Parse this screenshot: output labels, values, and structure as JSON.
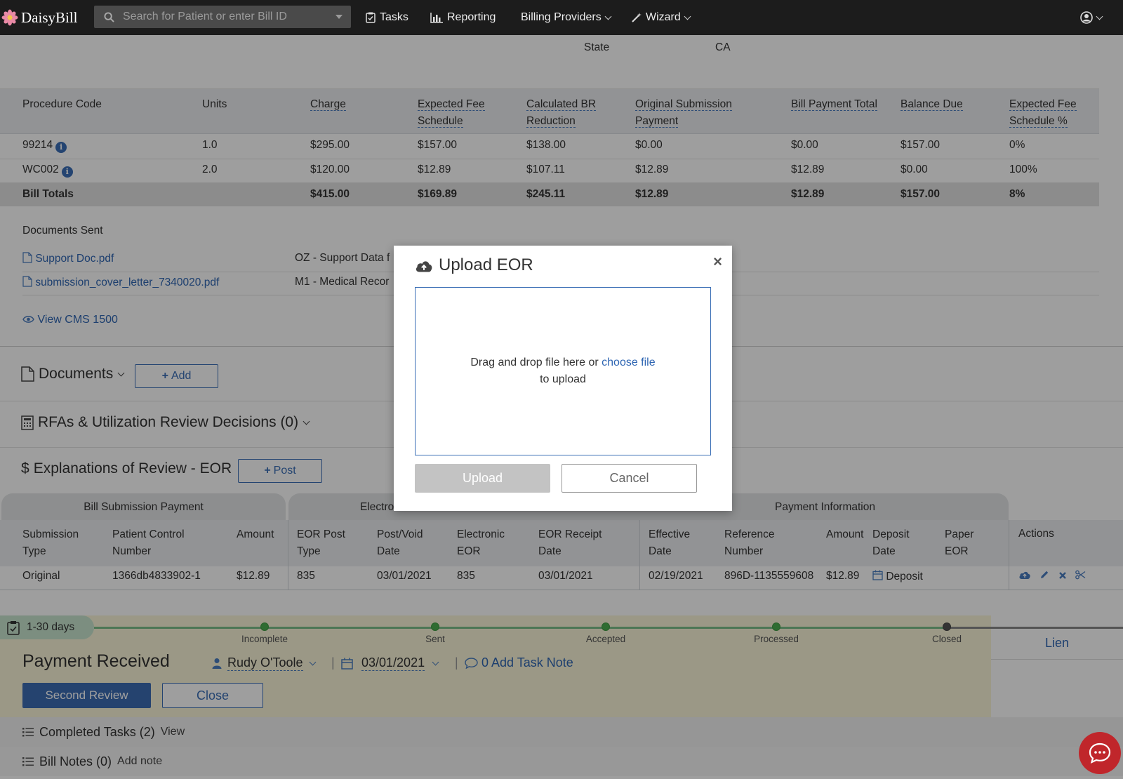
{
  "app": {
    "name": "DaisyBill"
  },
  "nav": {
    "search_placeholder": "Search for Patient or enter Bill ID",
    "tasks": "Tasks",
    "reporting": "Reporting",
    "billing_providers": "Billing Providers",
    "wizard": "Wizard"
  },
  "state": {
    "label": "State",
    "value": "CA"
  },
  "procedures": {
    "headers": {
      "code": "Procedure Code",
      "units": "Units",
      "charge": "Charge",
      "efs_1": "Expected Fee",
      "efs_2": "Schedule",
      "br_1": "Calculated BR",
      "br_2": "Reduction",
      "osp_1": "Original Submission",
      "osp_2": "Payment",
      "bpt": "Bill Payment Total",
      "balance": "Balance Due",
      "efsp_1": "Expected Fee",
      "efsp_2": "Schedule %"
    },
    "rows": [
      {
        "code": "99214",
        "units": "1.0",
        "charge": "$295.00",
        "efs": "$157.00",
        "br": "$138.00",
        "osp": "$0.00",
        "bpt": "$0.00",
        "balance": "$157.00",
        "efsp": "0%"
      },
      {
        "code": "WC002",
        "units": "2.0",
        "charge": "$120.00",
        "efs": "$12.89",
        "br": "$107.11",
        "osp": "$12.89",
        "bpt": "$12.89",
        "balance": "$0.00",
        "efsp": "100%"
      }
    ],
    "totals": {
      "label": "Bill Totals",
      "charge": "$415.00",
      "efs": "$169.89",
      "br": "$245.11",
      "osp": "$12.89",
      "bpt": "$12.89",
      "balance": "$157.00",
      "efsp": "8%"
    }
  },
  "documents_sent": {
    "title": "Documents Sent",
    "files": [
      {
        "name": "Support Doc.pdf",
        "type": "OZ - Support Data f"
      },
      {
        "name": "submission_cover_letter_7340020.pdf",
        "type": "M1 - Medical Recor"
      }
    ],
    "view_cms": "View CMS 1500"
  },
  "sections": {
    "documents": "Documents",
    "add": "Add",
    "rfas": "RFAs & Utilization Review Decisions (0)",
    "eor": "Explanations of Review - EOR",
    "post": "Post"
  },
  "eor_table": {
    "groups": {
      "bill_submission": "Bill Submission Payment",
      "electronic": "Electro",
      "payment_info": "Payment Information"
    },
    "headers": {
      "sub_type_1": "Submission",
      "sub_type_2": "Type",
      "pcn_1": "Patient Control",
      "pcn_2": "Number",
      "amount": "Amount",
      "post_type_1": "EOR Post",
      "post_type_2": "Type",
      "pv_1": "Post/Void",
      "pv_2": "Date",
      "el_1": "Electronic",
      "el_2": "EOR",
      "receipt_1": "EOR Receipt",
      "receipt_2": "Date",
      "eff_1": "Effective",
      "eff_2": "Date",
      "ref_1": "Reference",
      "ref_2": "Number",
      "pay_amount": "Amount",
      "dep_1": "Deposit",
      "dep_2": "Date",
      "paper_1": "Paper",
      "paper_2": "EOR",
      "actions": "Actions"
    },
    "row": {
      "sub_type": "Original",
      "pcn": "1366db4833902-1",
      "amount": "$12.89",
      "post_type": "835",
      "pv_date": "03/01/2021",
      "electronic_eor": "835",
      "receipt_date": "03/01/2021",
      "eff_date": "02/19/2021",
      "ref": "896D-1135559608",
      "pay_amount": "$12.89",
      "deposit": "Deposit"
    }
  },
  "status": {
    "days": "1-30 days",
    "steps": [
      "Incomplete",
      "Sent",
      "Accepted",
      "Processed",
      "Closed"
    ],
    "title": "Payment Received",
    "assignee": "Rudy O'Toole",
    "date": "03/01/2021",
    "task_note": "0 Add Task Note",
    "second_review": "Second Review",
    "close": "Close",
    "lien": "Lien"
  },
  "footer": {
    "completed_tasks": "Completed Tasks (2)",
    "view": "View",
    "bill_notes": "Bill Notes (0)",
    "add_note": "Add note"
  },
  "modal": {
    "title": "Upload EOR",
    "drop_text": "Drag and drop file here or",
    "choose_file": "choose file",
    "to_upload": "to upload",
    "upload": "Upload",
    "cancel": "Cancel"
  }
}
